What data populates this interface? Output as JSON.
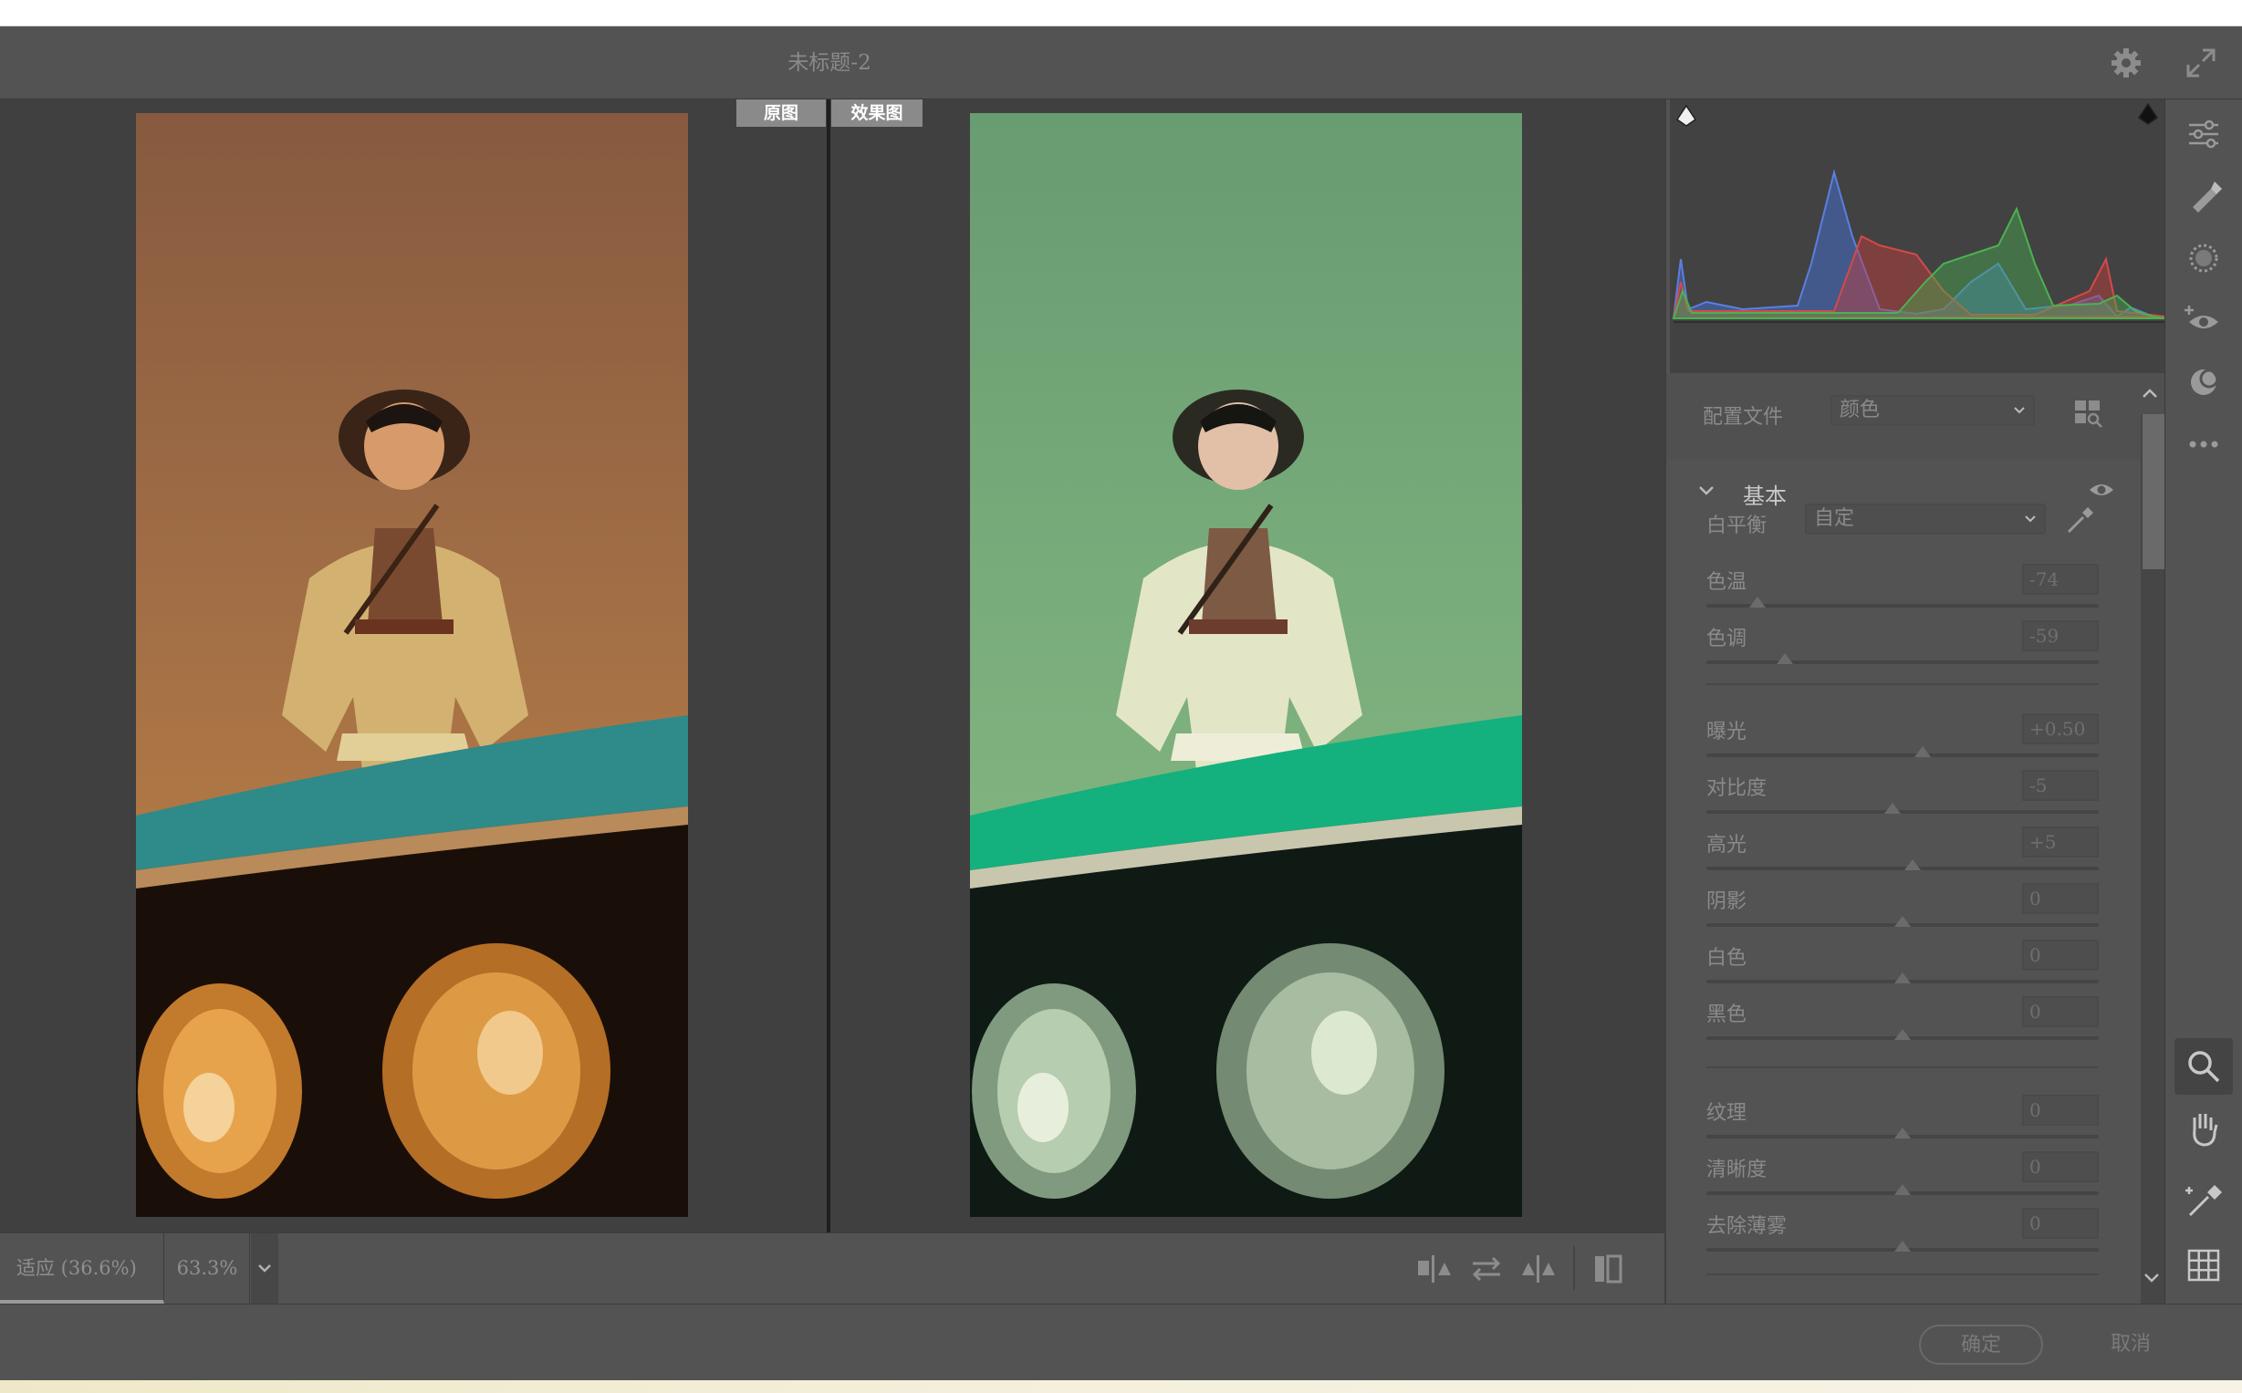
{
  "window": {
    "title": "未标题-2"
  },
  "preview": {
    "before_label": "原图",
    "after_label": "效果图",
    "zoom_fit": "适应 (36.6%)",
    "zoom_percent": "63.3%"
  },
  "panel": {
    "profile_label": "配置文件",
    "profile_value": "颜色",
    "section_title": "基本",
    "wb_label": "白平衡",
    "wb_value": "自定",
    "sliders_group1": [
      {
        "label": "色温",
        "value": "-74",
        "level": 0.13
      },
      {
        "label": "色调",
        "value": "-59",
        "level": 0.2
      }
    ],
    "sliders_group2": [
      {
        "label": "曝光",
        "value": "+0.50",
        "level": 0.55
      },
      {
        "label": "对比度",
        "value": "-5",
        "level": 0.475
      },
      {
        "label": "高光",
        "value": "+5",
        "level": 0.525
      },
      {
        "label": "阴影",
        "value": "0",
        "level": 0.5
      },
      {
        "label": "白色",
        "value": "0",
        "level": 0.5
      },
      {
        "label": "黑色",
        "value": "0",
        "level": 0.5
      }
    ],
    "sliders_group3": [
      {
        "label": "纹理",
        "value": "0",
        "level": 0.5
      },
      {
        "label": "清晰度",
        "value": "0",
        "level": 0.5
      },
      {
        "label": "去除薄雾",
        "value": "0",
        "level": 0.5
      }
    ]
  },
  "footer": {
    "ok_label": "确定",
    "cancel_label": "取消"
  },
  "colors": {
    "panel_bg": "#535353",
    "preview_bg": "#404040",
    "accent": "#8a8a8a"
  },
  "icons": [
    "gear-icon",
    "expand-icon",
    "sliders-icon",
    "healing-icon",
    "mask-icon",
    "redeye-icon",
    "presets-icon",
    "more-icon",
    "zoom-icon",
    "hand-icon",
    "color-sampler-icon",
    "grid-icon",
    "eyedropper-icon",
    "eye-icon"
  ]
}
